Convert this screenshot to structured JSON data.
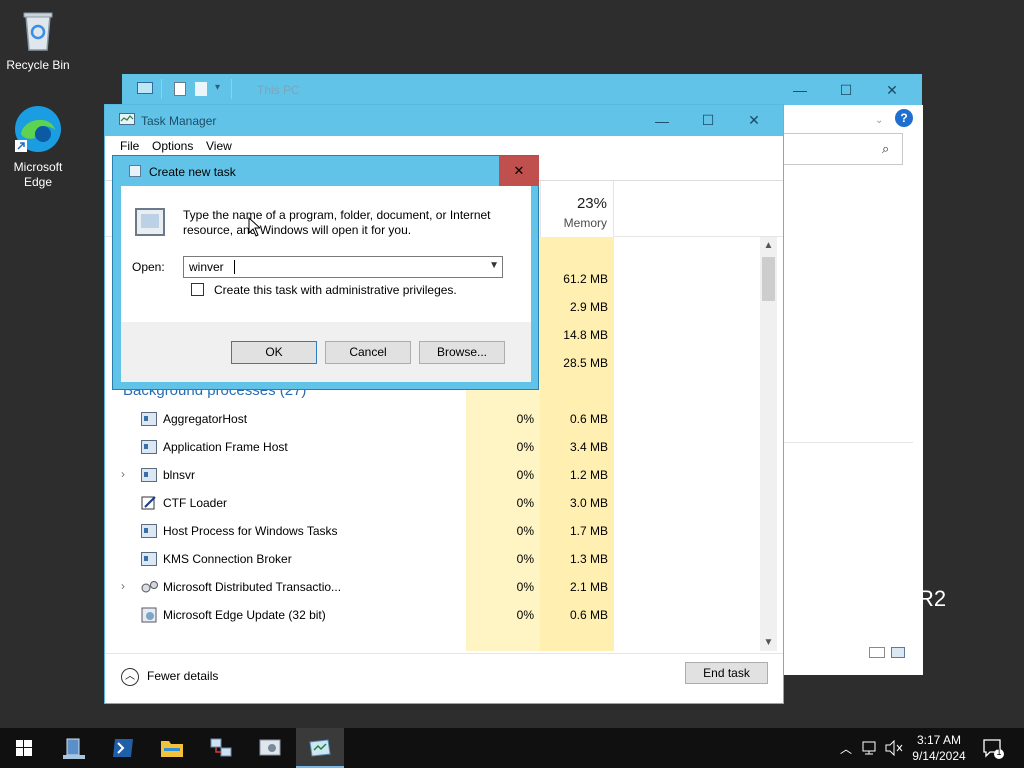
{
  "desktop": {
    "icons": [
      {
        "label": "Recycle Bin"
      },
      {
        "label": "Microsoft Edge"
      }
    ]
  },
  "explorer": {
    "title": "This PC",
    "controls": {
      "minimize": "—",
      "maximize": "☐",
      "close": "✕"
    },
    "help": "?",
    "search_icon": "search-icon",
    "watermark": "R2"
  },
  "task_manager": {
    "title": "Task Manager",
    "menu": [
      "File",
      "Options",
      "View"
    ],
    "controls": {
      "minimize": "—",
      "maximize": "☐",
      "close": "✕"
    },
    "memory_header": {
      "percent": "23%",
      "label": "Memory"
    },
    "app_memory": [
      "61.2 MB",
      "2.9 MB",
      "14.8 MB",
      "28.5 MB"
    ],
    "group_title": "Background processes (27)",
    "processes": [
      {
        "name": "AggregatorHost",
        "cpu": "0%",
        "memory": "0.6 MB",
        "expandable": false
      },
      {
        "name": "Application Frame Host",
        "cpu": "0%",
        "memory": "3.4 MB",
        "expandable": false
      },
      {
        "name": "blnsvr",
        "cpu": "0%",
        "memory": "1.2 MB",
        "expandable": true
      },
      {
        "name": "CTF Loader",
        "cpu": "0%",
        "memory": "3.0 MB",
        "expandable": false
      },
      {
        "name": "Host Process for Windows Tasks",
        "cpu": "0%",
        "memory": "1.7 MB",
        "expandable": false
      },
      {
        "name": "KMS Connection Broker",
        "cpu": "0%",
        "memory": "1.3 MB",
        "expandable": false
      },
      {
        "name": "Microsoft Distributed Transactio...",
        "cpu": "0%",
        "memory": "2.1 MB",
        "expandable": true
      },
      {
        "name": "Microsoft Edge Update (32 bit)",
        "cpu": "0%",
        "memory": "0.6 MB",
        "expandable": false
      }
    ],
    "fewer_details": "Fewer details",
    "end_task": "End task"
  },
  "run_dialog": {
    "title": "Create new task",
    "close": "✕",
    "message": "Type the name of a program, folder, document, or Internet resource, and Windows will open it for you.",
    "open_label": "Open:",
    "open_value": "winver",
    "admin_checkbox": "Create this task with administrative privileges.",
    "buttons": {
      "ok": "OK",
      "cancel": "Cancel",
      "browse": "Browse..."
    }
  },
  "taskbar": {
    "items": [
      "start-icon",
      "server-manager-icon",
      "powershell-icon",
      "file-explorer-icon",
      "network-icon",
      "control-panel-icon",
      "task-manager-icon"
    ],
    "clock": {
      "time": "3:17 AM",
      "date": "9/14/2024"
    },
    "notification_count": "1"
  }
}
